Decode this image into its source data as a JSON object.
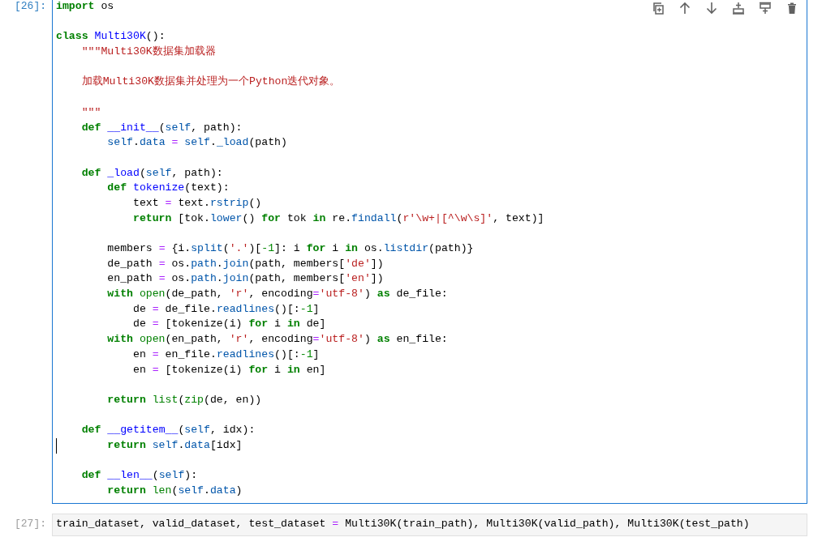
{
  "cells": [
    {
      "prompt": "[26]:",
      "selected": true,
      "lines": [
        {
          "kind": "code",
          "tokens": [
            {
              "kind": "kw",
              "text": "import"
            },
            {
              "kind": "plain",
              "text": " os"
            }
          ]
        },
        {
          "kind": "blank"
        },
        {
          "kind": "code",
          "tokens": [
            {
              "kind": "kw",
              "text": "class"
            },
            {
              "kind": "def",
              "text": " Multi30K"
            },
            {
              "kind": "plain",
              "text": "():"
            }
          ]
        },
        {
          "kind": "code",
          "tokens": [
            {
              "kind": "str",
              "text": "    \"\"\"Multi30K数据集加载器"
            }
          ]
        },
        {
          "kind": "blank"
        },
        {
          "kind": "code",
          "tokens": [
            {
              "kind": "str",
              "text": "    加载Multi30K数据集并处理为一个Python迭代对象。"
            }
          ]
        },
        {
          "kind": "blank"
        },
        {
          "kind": "code",
          "tokens": [
            {
              "kind": "str",
              "text": "    \"\"\""
            }
          ]
        },
        {
          "kind": "code",
          "tokens": [
            {
              "kind": "kw",
              "text": "    def"
            },
            {
              "kind": "def",
              "text": " __init__"
            },
            {
              "kind": "plain",
              "text": "("
            },
            {
              "kind": "var",
              "text": "self"
            },
            {
              "kind": "plain",
              "text": ", path):"
            }
          ]
        },
        {
          "kind": "code",
          "tokens": [
            {
              "kind": "var",
              "text": "        self"
            },
            {
              "kind": "plain",
              "text": "."
            },
            {
              "kind": "var",
              "text": "data"
            },
            {
              "kind": "op",
              "text": " ="
            },
            {
              "kind": "var",
              "text": " self"
            },
            {
              "kind": "plain",
              "text": "."
            },
            {
              "kind": "var",
              "text": "_load"
            },
            {
              "kind": "plain",
              "text": "(path)"
            }
          ]
        },
        {
          "kind": "blank"
        },
        {
          "kind": "code",
          "tokens": [
            {
              "kind": "kw",
              "text": "    def"
            },
            {
              "kind": "def",
              "text": " _load"
            },
            {
              "kind": "plain",
              "text": "("
            },
            {
              "kind": "var",
              "text": "self"
            },
            {
              "kind": "plain",
              "text": ", path):"
            }
          ]
        },
        {
          "kind": "code",
          "tokens": [
            {
              "kind": "kw",
              "text": "        def"
            },
            {
              "kind": "def",
              "text": " tokenize"
            },
            {
              "kind": "plain",
              "text": "(text):"
            }
          ]
        },
        {
          "kind": "code",
          "tokens": [
            {
              "kind": "plain",
              "text": "            text "
            },
            {
              "kind": "op",
              "text": "="
            },
            {
              "kind": "plain",
              "text": " text."
            },
            {
              "kind": "var",
              "text": "rstrip"
            },
            {
              "kind": "plain",
              "text": "()"
            }
          ]
        },
        {
          "kind": "code",
          "tokens": [
            {
              "kind": "kw",
              "text": "            return"
            },
            {
              "kind": "plain",
              "text": " [tok."
            },
            {
              "kind": "var",
              "text": "lower"
            },
            {
              "kind": "plain",
              "text": "() "
            },
            {
              "kind": "kw",
              "text": "for"
            },
            {
              "kind": "plain",
              "text": " tok "
            },
            {
              "kind": "kw",
              "text": "in"
            },
            {
              "kind": "plain",
              "text": " re."
            },
            {
              "kind": "var",
              "text": "findall"
            },
            {
              "kind": "plain",
              "text": "("
            },
            {
              "kind": "str",
              "text": "r'\\w+|[^\\w\\s]'"
            },
            {
              "kind": "plain",
              "text": ", text)]"
            }
          ]
        },
        {
          "kind": "blank"
        },
        {
          "kind": "code",
          "tokens": [
            {
              "kind": "plain",
              "text": "        members "
            },
            {
              "kind": "op",
              "text": "="
            },
            {
              "kind": "plain",
              "text": " {i."
            },
            {
              "kind": "var",
              "text": "split"
            },
            {
              "kind": "plain",
              "text": "("
            },
            {
              "kind": "str",
              "text": "'.'"
            },
            {
              "kind": "plain",
              "text": ")["
            },
            {
              "kind": "num",
              "text": "-1"
            },
            {
              "kind": "plain",
              "text": "]: i "
            },
            {
              "kind": "kw",
              "text": "for"
            },
            {
              "kind": "plain",
              "text": " i "
            },
            {
              "kind": "kw",
              "text": "in"
            },
            {
              "kind": "plain",
              "text": " os."
            },
            {
              "kind": "var",
              "text": "listdir"
            },
            {
              "kind": "plain",
              "text": "(path)}"
            }
          ]
        },
        {
          "kind": "code",
          "tokens": [
            {
              "kind": "plain",
              "text": "        de_path "
            },
            {
              "kind": "op",
              "text": "="
            },
            {
              "kind": "plain",
              "text": " os."
            },
            {
              "kind": "var",
              "text": "path"
            },
            {
              "kind": "plain",
              "text": "."
            },
            {
              "kind": "var",
              "text": "join"
            },
            {
              "kind": "plain",
              "text": "(path, members["
            },
            {
              "kind": "str",
              "text": "'de'"
            },
            {
              "kind": "plain",
              "text": "])"
            }
          ]
        },
        {
          "kind": "code",
          "tokens": [
            {
              "kind": "plain",
              "text": "        en_path "
            },
            {
              "kind": "op",
              "text": "="
            },
            {
              "kind": "plain",
              "text": " os."
            },
            {
              "kind": "var",
              "text": "path"
            },
            {
              "kind": "plain",
              "text": "."
            },
            {
              "kind": "var",
              "text": "join"
            },
            {
              "kind": "plain",
              "text": "(path, members["
            },
            {
              "kind": "str",
              "text": "'en'"
            },
            {
              "kind": "plain",
              "text": "])"
            }
          ]
        },
        {
          "kind": "code",
          "tokens": [
            {
              "kind": "kw",
              "text": "        with"
            },
            {
              "kind": "builtin",
              "text": " open"
            },
            {
              "kind": "plain",
              "text": "(de_path, "
            },
            {
              "kind": "str",
              "text": "'r'"
            },
            {
              "kind": "plain",
              "text": ", encoding"
            },
            {
              "kind": "op",
              "text": "="
            },
            {
              "kind": "str",
              "text": "'utf-8'"
            },
            {
              "kind": "plain",
              "text": ") "
            },
            {
              "kind": "kw",
              "text": "as"
            },
            {
              "kind": "plain",
              "text": " de_file:"
            }
          ]
        },
        {
          "kind": "code",
          "tokens": [
            {
              "kind": "plain",
              "text": "            de "
            },
            {
              "kind": "op",
              "text": "="
            },
            {
              "kind": "plain",
              "text": " de_file."
            },
            {
              "kind": "var",
              "text": "readlines"
            },
            {
              "kind": "plain",
              "text": "()[:"
            },
            {
              "kind": "num",
              "text": "-1"
            },
            {
              "kind": "plain",
              "text": "]"
            }
          ]
        },
        {
          "kind": "code",
          "tokens": [
            {
              "kind": "plain",
              "text": "            de "
            },
            {
              "kind": "op",
              "text": "="
            },
            {
              "kind": "plain",
              "text": " [tokenize(i) "
            },
            {
              "kind": "kw",
              "text": "for"
            },
            {
              "kind": "plain",
              "text": " i "
            },
            {
              "kind": "kw",
              "text": "in"
            },
            {
              "kind": "plain",
              "text": " de]"
            }
          ]
        },
        {
          "kind": "code",
          "tokens": [
            {
              "kind": "kw",
              "text": "        with"
            },
            {
              "kind": "builtin",
              "text": " open"
            },
            {
              "kind": "plain",
              "text": "(en_path, "
            },
            {
              "kind": "str",
              "text": "'r'"
            },
            {
              "kind": "plain",
              "text": ", encoding"
            },
            {
              "kind": "op",
              "text": "="
            },
            {
              "kind": "str",
              "text": "'utf-8'"
            },
            {
              "kind": "plain",
              "text": ") "
            },
            {
              "kind": "kw",
              "text": "as"
            },
            {
              "kind": "plain",
              "text": " en_file:"
            }
          ]
        },
        {
          "kind": "code",
          "tokens": [
            {
              "kind": "plain",
              "text": "            en "
            },
            {
              "kind": "op",
              "text": "="
            },
            {
              "kind": "plain",
              "text": " en_file."
            },
            {
              "kind": "var",
              "text": "readlines"
            },
            {
              "kind": "plain",
              "text": "()[:"
            },
            {
              "kind": "num",
              "text": "-1"
            },
            {
              "kind": "plain",
              "text": "]"
            }
          ]
        },
        {
          "kind": "code",
          "tokens": [
            {
              "kind": "plain",
              "text": "            en "
            },
            {
              "kind": "op",
              "text": "="
            },
            {
              "kind": "plain",
              "text": " [tokenize(i) "
            },
            {
              "kind": "kw",
              "text": "for"
            },
            {
              "kind": "plain",
              "text": " i "
            },
            {
              "kind": "kw",
              "text": "in"
            },
            {
              "kind": "plain",
              "text": " en]"
            }
          ]
        },
        {
          "kind": "blank"
        },
        {
          "kind": "code",
          "tokens": [
            {
              "kind": "kw",
              "text": "        return"
            },
            {
              "kind": "builtin",
              "text": " list"
            },
            {
              "kind": "plain",
              "text": "("
            },
            {
              "kind": "builtin",
              "text": "zip"
            },
            {
              "kind": "plain",
              "text": "(de, en))"
            }
          ]
        },
        {
          "kind": "blank"
        },
        {
          "kind": "code",
          "tokens": [
            {
              "kind": "kw",
              "text": "    def"
            },
            {
              "kind": "def",
              "text": " __getitem__"
            },
            {
              "kind": "plain",
              "text": "("
            },
            {
              "kind": "var",
              "text": "self"
            },
            {
              "kind": "plain",
              "text": ", idx):"
            }
          ]
        },
        {
          "kind": "code",
          "cursor": true,
          "tokens": [
            {
              "kind": "kw",
              "text": "        return"
            },
            {
              "kind": "var",
              "text": " self"
            },
            {
              "kind": "plain",
              "text": "."
            },
            {
              "kind": "var",
              "text": "data"
            },
            {
              "kind": "plain",
              "text": "[idx]"
            }
          ]
        },
        {
          "kind": "blank"
        },
        {
          "kind": "code",
          "tokens": [
            {
              "kind": "kw",
              "text": "    def"
            },
            {
              "kind": "def",
              "text": " __len__"
            },
            {
              "kind": "plain",
              "text": "("
            },
            {
              "kind": "var",
              "text": "self"
            },
            {
              "kind": "plain",
              "text": "):"
            }
          ]
        },
        {
          "kind": "code",
          "tokens": [
            {
              "kind": "kw",
              "text": "        return"
            },
            {
              "kind": "builtin",
              "text": " len"
            },
            {
              "kind": "plain",
              "text": "("
            },
            {
              "kind": "var",
              "text": "self"
            },
            {
              "kind": "plain",
              "text": "."
            },
            {
              "kind": "var",
              "text": "data"
            },
            {
              "kind": "plain",
              "text": ")"
            }
          ]
        }
      ]
    },
    {
      "prompt": "[27]:",
      "selected": false,
      "lines": [
        {
          "kind": "code",
          "tokens": [
            {
              "kind": "plain",
              "text": "train_dataset, valid_dataset, test_dataset "
            },
            {
              "kind": "op",
              "text": "="
            },
            {
              "kind": "plain",
              "text": " Multi30K(train_path), Multi30K(valid_path), Multi30K(test_path)"
            }
          ]
        }
      ]
    }
  ]
}
